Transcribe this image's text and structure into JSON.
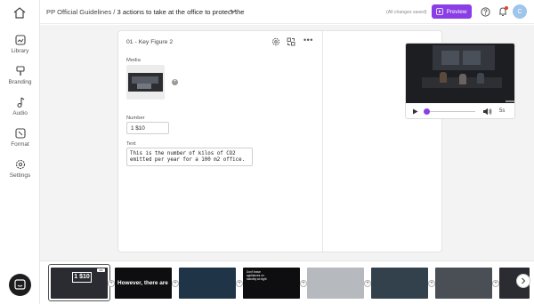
{
  "sidebar": {
    "items": [
      {
        "label": "Library",
        "icon": "library-icon"
      },
      {
        "label": "Branding",
        "icon": "branding-icon"
      },
      {
        "label": "Audio",
        "icon": "audio-icon"
      },
      {
        "label": "Format",
        "icon": "format-icon"
      },
      {
        "label": "Settings",
        "icon": "gear-icon"
      }
    ]
  },
  "header": {
    "breadcrumb_root": "PP Official Guidelines",
    "separator": "/",
    "project_title": "3 actions to take at the office to protect the",
    "save_status": "(All changes saved)",
    "preview_label": "Preview",
    "avatar_initial": "C"
  },
  "editor": {
    "panel_title": "01 - Key Figure 2",
    "media_label": "Media",
    "number_label": "Number",
    "number_value": "1 $10",
    "text_label": "Text",
    "text_value": "This is the number of kilos of CO2 emitted per year for a 100 m2 office."
  },
  "player": {
    "duration": "5s",
    "progress": 0.0
  },
  "timeline": {
    "frames": [
      {
        "kind": "key-figure",
        "number": "1 $10",
        "more": "•••"
      },
      {
        "kind": "text",
        "text": "However, there are"
      },
      {
        "kind": "video"
      },
      {
        "kind": "text-caption",
        "text": "Don't leave appliances on standby at night"
      },
      {
        "kind": "video"
      },
      {
        "kind": "video"
      },
      {
        "kind": "video"
      },
      {
        "kind": "video"
      }
    ]
  },
  "colors": {
    "accent": "#8a3ee6",
    "notification": "#e0452b",
    "avatar": "#9ec5ea"
  }
}
